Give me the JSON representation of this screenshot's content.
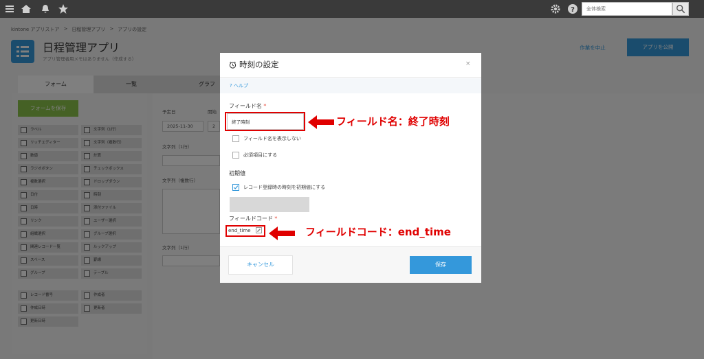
{
  "topbar": {
    "search_placeholder": "全体検索",
    "icons": [
      "menu-icon",
      "home-icon",
      "bell-icon",
      "star-icon",
      "gear-icon",
      "help-icon",
      "search-icon"
    ]
  },
  "breadcrumb": [
    "kintone アプリストア",
    ">",
    "日程管理アプリ",
    ">",
    "アプリの設定"
  ],
  "app": {
    "title": "日程管理アプリ",
    "subtitle": "アプリ管理者用メモはありません（作成する）"
  },
  "header_buttons": {
    "stop": "作業を中止",
    "publish": "アプリを公開"
  },
  "tabs": [
    {
      "label": "フォーム"
    },
    {
      "label": "一覧"
    },
    {
      "label": "グラフ"
    }
  ],
  "palette": {
    "save_label": "フォームを保存",
    "items": [
      "ラベル",
      "文字列（1行）",
      "リッチエディター",
      "文字列（複数行）",
      "数値",
      "計算",
      "ラジオボタン",
      "チェックボックス",
      "複数選択",
      "ドロップダウン",
      "日付",
      "時刻",
      "日時",
      "添付ファイル",
      "リンク",
      "ユーザー選択",
      "組織選択",
      "グループ選択",
      "関連レコード一覧",
      "ルックアップ",
      "スペース",
      "罫線",
      "グループ",
      "テーブル"
    ],
    "system_items": [
      "レコード番号",
      "作成者",
      "作成日時",
      "更新者",
      "更新日時"
    ]
  },
  "canvas": {
    "field1_label": "予定日",
    "field1_value": "2025-11-30",
    "field2_label": "開始",
    "field2_value": "2",
    "text1_label": "文字列（1行）",
    "textm_label": "文字列（複数行）",
    "text2_label": "文字列（1行）"
  },
  "modal": {
    "title": "時刻の設定",
    "close": "×",
    "help": "? ヘルプ",
    "field_name_label": "フィールド名",
    "required_mark": "*",
    "field_name_value": "終了時刻",
    "hide_name_label": "フィールド名を表示しない",
    "required_label": "必須項目にする",
    "default_label": "初期値",
    "default_now_label": "レコード登録時の時刻を初期値にする",
    "field_code_label": "フィールドコード",
    "field_code_value": "end_time",
    "cancel": "キャンセル",
    "save": "保存"
  },
  "annotations": {
    "name_note": "フィールド名：終了時刻",
    "code_note": "フィールドコード：end_time",
    "color": "#e00000"
  }
}
